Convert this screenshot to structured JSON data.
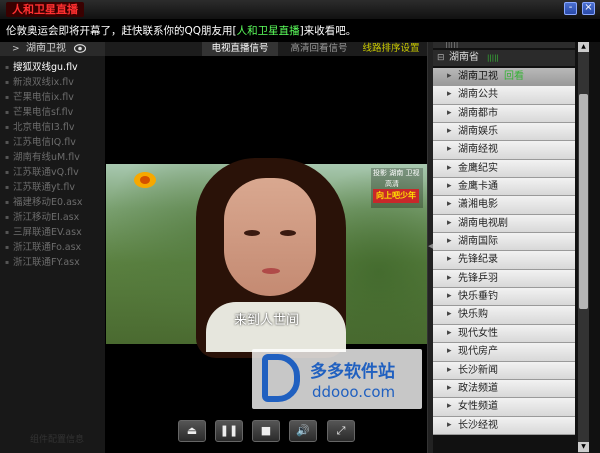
{
  "app": {
    "title": "人和卫星直播",
    "min_label": "-",
    "close_label": "×"
  },
  "notice": {
    "prefix": "伦敦奥运会即将开幕了，赶快联系你的QQ朋友用[",
    "link": "人和卫星直播",
    "suffix": "]来收看吧。"
  },
  "left": {
    "arrow": ">",
    "header": "湖南卫视",
    "channels": [
      "搜狐双线gu.flv",
      "新浪双线ix.flv",
      "芒果电信ix.flv",
      "芒果电信sf.flv",
      "北京电信I3.flv",
      "江苏电信IQ.flv",
      "湖南有线uM.flv",
      "江苏联通vQ.flv",
      "江苏联通yt.flv",
      "福建移动E0.asx",
      "浙江移动EI.asx",
      "三屏联通EV.asx",
      "浙江联通Fo.asx",
      "浙江联通FY.asx"
    ],
    "footer": "组件配置信息"
  },
  "tabs": [
    "电视直播信号",
    "高清回看信号",
    "线路排序设置"
  ],
  "video": {
    "subtitle": "来到人世间",
    "badge_line1": "投影 湖南 卫视",
    "badge_line2": "高清",
    "badge_show": "向上吧少年"
  },
  "watermark": {
    "name": "多多软件站",
    "url": "ddooo.com"
  },
  "controls": [
    {
      "name": "eject-button",
      "icon": "⏏"
    },
    {
      "name": "pause-button",
      "icon": "❚❚"
    },
    {
      "name": "stop-button",
      "icon": "■"
    },
    {
      "name": "volume-button",
      "icon": "🔊"
    },
    {
      "name": "fullscreen-button",
      "icon": "⤢"
    }
  ],
  "right": {
    "group": "湖南省",
    "signal_marks": "|||||",
    "channels": [
      {
        "name": "湖南卫视",
        "tag": "回看"
      },
      {
        "name": "湖南公共"
      },
      {
        "name": "湖南都市"
      },
      {
        "name": "湖南娱乐"
      },
      {
        "name": "湖南经视"
      },
      {
        "name": "金鹰纪实"
      },
      {
        "name": "金鹰卡通"
      },
      {
        "name": "潇湘电影"
      },
      {
        "name": "湖南电视剧"
      },
      {
        "name": "湖南国际"
      },
      {
        "name": "先锋纪录"
      },
      {
        "name": "先锋乒羽"
      },
      {
        "name": "快乐垂钓"
      },
      {
        "name": "快乐购"
      },
      {
        "name": "现代女性"
      },
      {
        "name": "现代房产"
      },
      {
        "name": "长沙新闻"
      },
      {
        "name": "政法频道"
      },
      {
        "name": "女性频道"
      },
      {
        "name": "长沙经视"
      }
    ]
  }
}
